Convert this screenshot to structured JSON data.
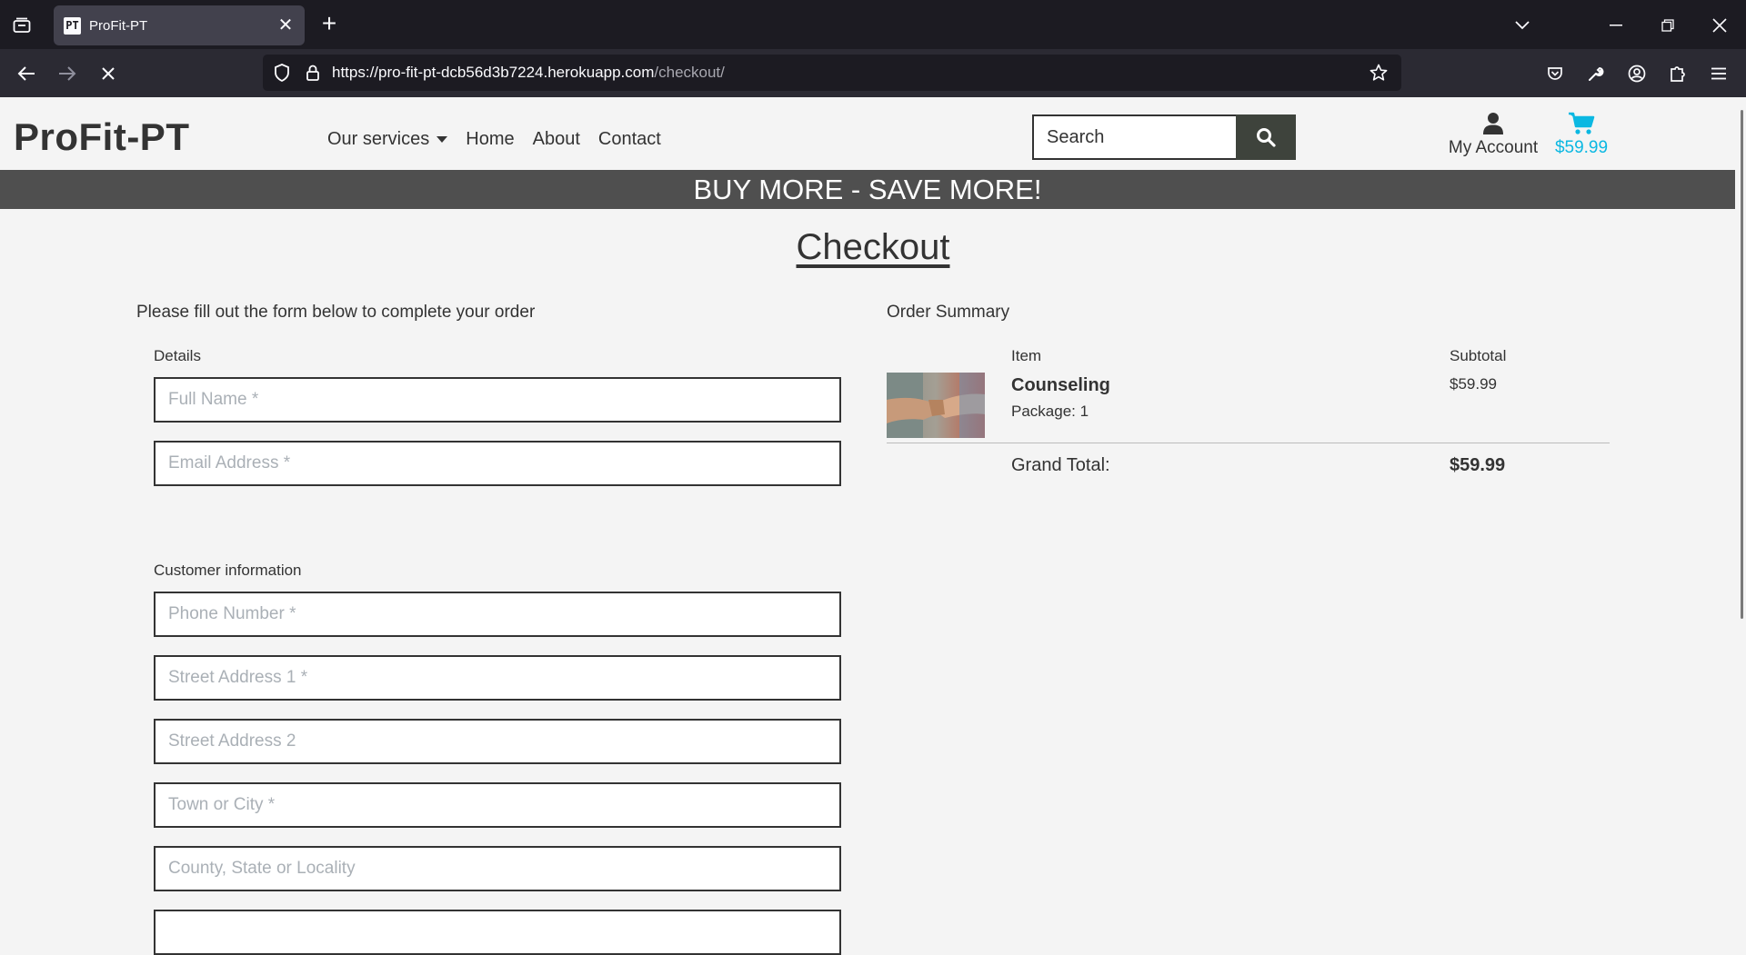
{
  "browser": {
    "tab_title": "ProFit-PT",
    "favicon_text": "PT",
    "url_host": "https://pro-fit-pt-dcb56d3b7224.herokuapp.com",
    "url_path": "/checkout/"
  },
  "site": {
    "brand": "ProFit-PT",
    "nav": {
      "services": "Our services",
      "home": "Home",
      "about": "About",
      "contact": "Contact"
    },
    "search_placeholder": "Search",
    "account_label": "My Account",
    "cart_total": "$59.99",
    "cart_color": "#0bb8e2",
    "banner": "BUY MORE - SAVE MORE!"
  },
  "checkout": {
    "title": "Checkout",
    "intro": "Please fill out the form below to complete your order",
    "details_label": "Details",
    "customer_label": "Customer information",
    "fields": {
      "full_name": "Full Name *",
      "email": "Email Address *",
      "phone": "Phone Number *",
      "street1": "Street Address 1 *",
      "street2": "Street Address 2",
      "town": "Town or City *",
      "county": "County, State or Locality"
    }
  },
  "summary": {
    "title": "Order Summary",
    "col_item": "Item",
    "col_subtotal": "Subtotal",
    "item": {
      "name": "Counseling",
      "package": "Package: 1",
      "price": "$59.99"
    },
    "grand_total_label": "Grand Total:",
    "grand_total_value": "$59.99"
  }
}
